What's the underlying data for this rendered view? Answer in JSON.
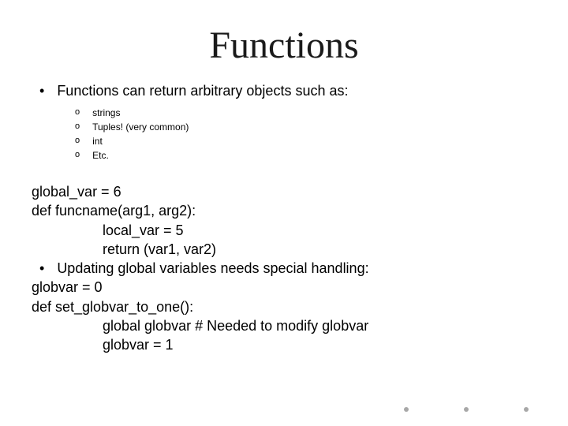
{
  "title": "Functions",
  "bullet1": "Functions can return arbitrary objects such as:",
  "subs": {
    "s0": "strings",
    "s1": "Tuples! (very common)",
    "s2": "int",
    "s3": "Etc."
  },
  "code": {
    "l0": "global_var = 6",
    "l1": "def funcname(arg1, arg2):",
    "l2": "local_var = 5",
    "l3": "return (var1, var2)"
  },
  "bullet2": "Updating global variables needs special handling:",
  "code2": {
    "l0": "globvar = 0",
    "l1": "def set_globvar_to_one():",
    "l2": "global globvar # Needed to modify globvar",
    "l3": "globvar = 1"
  },
  "markers": {
    "bullet": "•",
    "sub": "o"
  }
}
